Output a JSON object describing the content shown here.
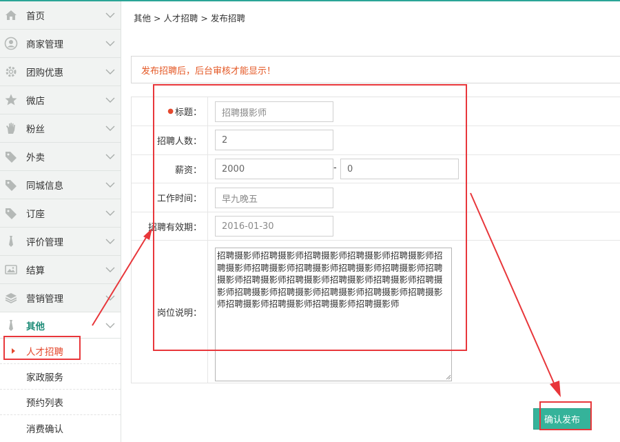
{
  "sidebar": {
    "items": [
      {
        "label": "首页",
        "icon": "home-icon"
      },
      {
        "label": "商家管理",
        "icon": "user-circle-icon"
      },
      {
        "label": "团购优惠",
        "icon": "gear-icon"
      },
      {
        "label": "微店",
        "icon": "star-icon"
      },
      {
        "label": "粉丝",
        "icon": "hand-icon"
      },
      {
        "label": "外卖",
        "icon": "tag-icon"
      },
      {
        "label": "同城信息",
        "icon": "tag-icon"
      },
      {
        "label": "订座",
        "icon": "tag-icon"
      },
      {
        "label": "评价管理",
        "icon": "tie-icon"
      },
      {
        "label": "结算",
        "icon": "image-icon"
      },
      {
        "label": "营销管理",
        "icon": "layers-icon"
      },
      {
        "label": "其他",
        "icon": "tie-icon"
      }
    ],
    "sub_items": [
      {
        "label": "人才招聘"
      },
      {
        "label": "家政服务"
      },
      {
        "label": "预约列表"
      },
      {
        "label": "消费确认"
      }
    ]
  },
  "breadcrumb": "其他 > 人才招聘 > 发布招聘",
  "notice": "发布招聘后，后台审核才能显示！",
  "form": {
    "required_mark": "●",
    "title_label": "标题：",
    "title_placeholder": "招聘摄影师",
    "count_label": "招聘人数：",
    "count_value": "2",
    "salary_label": "薪资：",
    "salary_min": "2000",
    "salary_sep": "-",
    "salary_max": "0",
    "worktime_label": "工作时间：",
    "worktime_placeholder": "早九晚五",
    "validity_label": "招聘有效期：",
    "validity_value": "2016-01-30",
    "desc_label": "岗位说明：",
    "desc_value": "招聘摄影师招聘摄影师招聘摄影师招聘摄影师招聘摄影师招聘摄影师招聘摄影师招聘摄影师招聘摄影师招聘摄影师招聘摄影师招聘摄影师招聘摄影师招聘摄影师招聘摄影师招聘摄影师招聘摄影师招聘摄影师招聘摄影师招聘摄影师招聘摄影师招聘摄影师招聘摄影师招聘摄影师招聘摄影师"
  },
  "submit_label": "确认发布",
  "colors": {
    "accent": "#35b39a",
    "annotation": "#e8363a",
    "notice": "#e45724"
  }
}
